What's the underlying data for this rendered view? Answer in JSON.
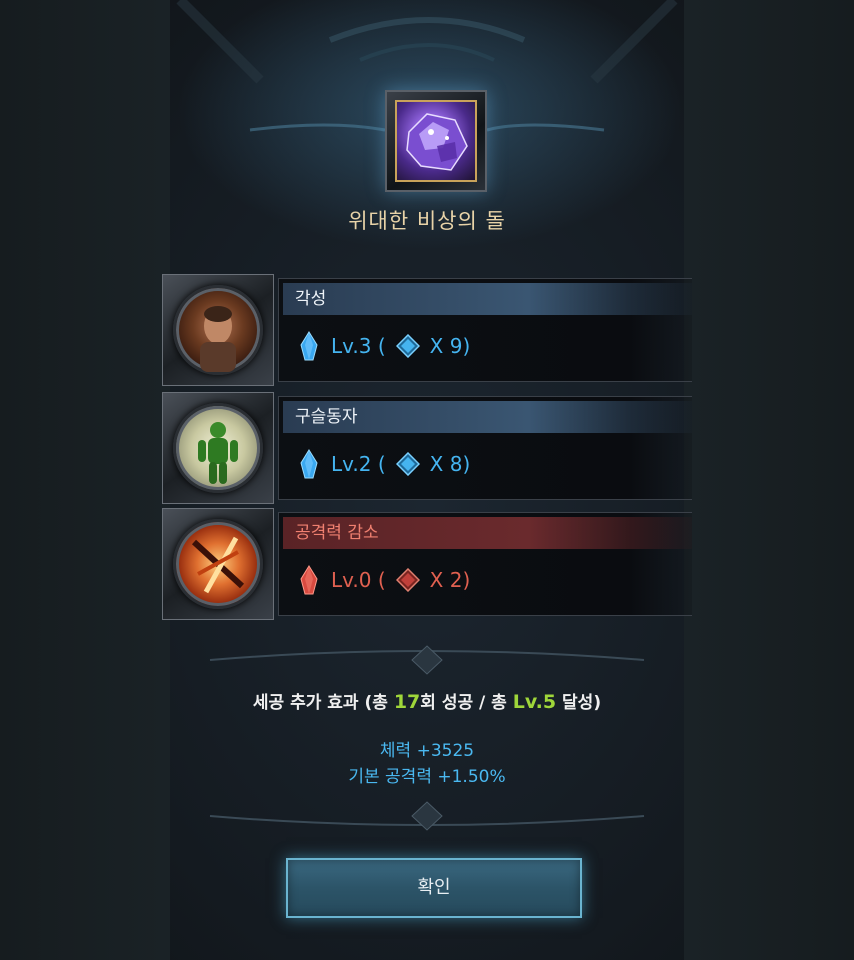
{
  "item": {
    "name": "위대한 비상의 돌",
    "icon": "purple-crystal-stone-icon"
  },
  "skills": [
    {
      "name": "각성",
      "theme": "blue",
      "portrait_icon": "awakened-warrior-portrait-icon",
      "level_text": "Lv.3 (",
      "count_text": "X 9)",
      "gem_color": "#3aa8f0",
      "rune_icon": "blue-rune-icon"
    },
    {
      "name": "구슬동자",
      "theme": "blue",
      "portrait_icon": "green-bead-figure-portrait-icon",
      "level_text": "Lv.2 (",
      "count_text": "X 8)",
      "gem_color": "#3aa8f0",
      "rune_icon": "blue-rune-icon"
    },
    {
      "name": "공격력 감소",
      "theme": "red",
      "portrait_icon": "attack-down-portrait-icon",
      "level_text": "Lv.0 (",
      "count_text": "X 2)",
      "gem_color": "#d84a40",
      "rune_icon": "red-rune-icon"
    }
  ],
  "bonus": {
    "title_prefix": "세공 추가 효과 (총 ",
    "success_count": "17",
    "title_middle": "회 성공 / 총 ",
    "total_level": "Lv.5",
    "title_suffix": " 달성)",
    "lines": [
      "체력 +3525",
      "기본 공격력 +1.50%"
    ]
  },
  "confirm_label": "확인",
  "colors": {
    "accent_blue": "#45b4f0",
    "accent_red": "#e06050",
    "accent_green": "#9fd63a",
    "title_gold": "#e8d3a8"
  }
}
